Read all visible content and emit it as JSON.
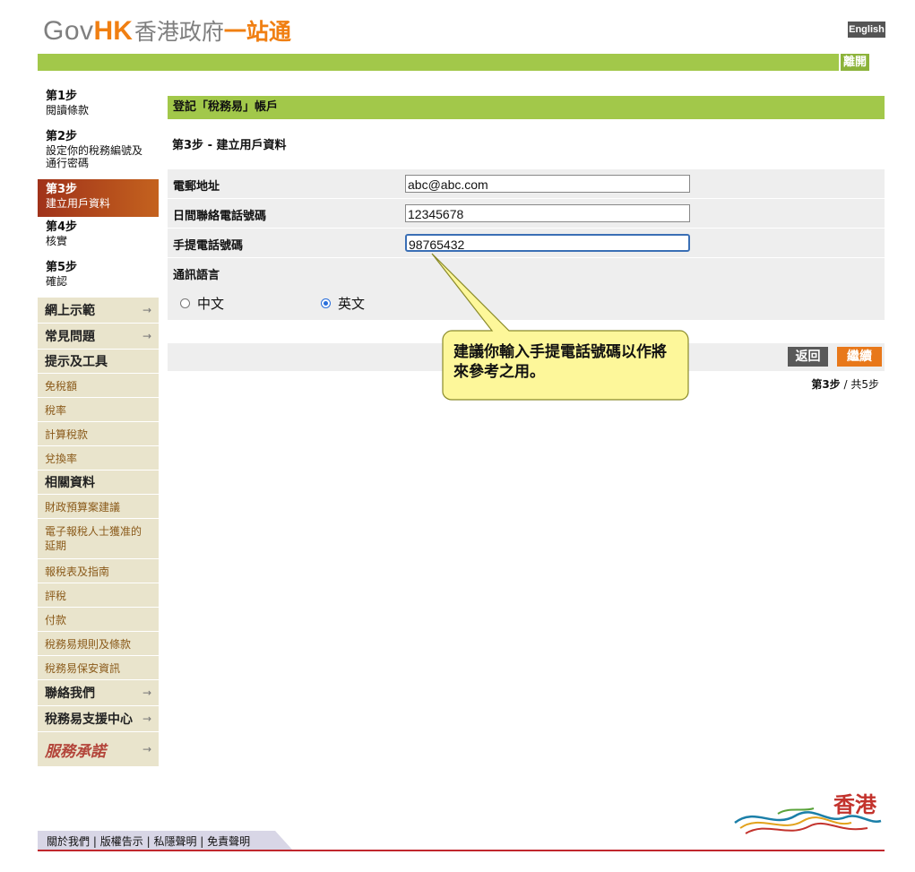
{
  "header": {
    "logo_gov": "Gov",
    "logo_hk": "HK",
    "logo_zh_gray": "香港政府",
    "logo_zh_orange": "一站通",
    "english_label": "English",
    "leave_label": "離開"
  },
  "sidebar": {
    "steps": [
      {
        "num": "第1步",
        "desc": "閱讀條款"
      },
      {
        "num": "第2步",
        "desc": "設定你的稅務編號及通行密碼"
      },
      {
        "num": "第3步",
        "desc": "建立用戶資料"
      },
      {
        "num": "第4步",
        "desc": "核實"
      },
      {
        "num": "第5步",
        "desc": "確認"
      }
    ],
    "menu": {
      "demo": "網上示範",
      "faq": "常見問題",
      "tips_heading": "提示及工具",
      "allowances": "免稅額",
      "tax_rates": "稅率",
      "calc_tax": "計算稅款",
      "exchange": "兌換率",
      "related_heading": "相關資料",
      "budget": "財政預算案建議",
      "extension": "電子報稅人士獲准的延期",
      "returns": "報稅表及指南",
      "assessment": "評稅",
      "payment": "付款",
      "rules": "稅務易規則及條款",
      "security": "稅務易保安資訊",
      "contact": "聯絡我們",
      "support": "稅務易支援中心",
      "pledge": "服務承諾"
    },
    "arrow": "→"
  },
  "main": {
    "section_title": "登記「稅務易」帳戶",
    "step_title": "第3步 - 建立用戶資料",
    "fields": {
      "email_label": "電郵地址",
      "email_value": "abc@abc.com",
      "day_phone_label": "日間聯絡電話號碼",
      "day_phone_value": "12345678",
      "mobile_label": "手提電話號碼",
      "mobile_value": "98765432",
      "language_label": "通訊語言",
      "lang_chinese": "中文",
      "lang_english": "英文",
      "selected_language": "英文"
    },
    "back_label": "返回",
    "continue_label": "繼續",
    "step_count_bold": "第3步",
    "step_count_rest": " / 共5步",
    "callout": "建議你輸入手提電話號碼以作將來參考之用。"
  },
  "footer": {
    "about": "關於我們",
    "copyright": "版權告示",
    "privacy": "私隱聲明",
    "disclaimer": "免責聲明",
    "separator": "|",
    "brand": "香港"
  },
  "colors": {
    "green_bar": "#a2c84a",
    "active_step": "#b0401c",
    "orange": "#e8781a",
    "sidebar_bg": "#e9e4cc",
    "footer_line": "#c0272d",
    "callout_fill": "#fdf79a"
  }
}
